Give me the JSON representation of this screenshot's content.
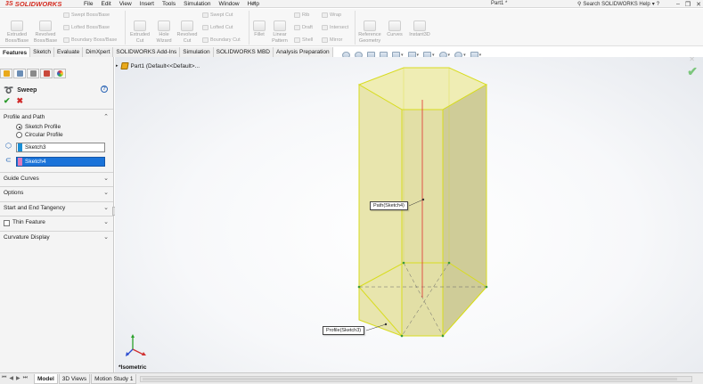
{
  "app": {
    "brand": "SOLIDWORKS",
    "brand_mark": "3S",
    "document_title": "Part1 *",
    "search_placeholder": "Search SOLIDWORKS Help",
    "menu": [
      "File",
      "Edit",
      "View",
      "Insert",
      "Tools",
      "Simulation",
      "Window",
      "Help"
    ]
  },
  "command_manager": {
    "extruded_boss": "Extruded Boss/Base",
    "revolved_boss": "Revolved Boss/Base",
    "swept_boss": "Swept Boss/Base",
    "lofted_boss": "Lofted Boss/Base",
    "boundary_boss": "Boundary Boss/Base",
    "extruded_cut": "Extruded Cut",
    "hole_wizard": "Hole Wizard",
    "revolved_cut": "Revolved Cut",
    "swept_cut": "Swept Cut",
    "lofted_cut": "Lofted Cut",
    "boundary_cut": "Boundary Cut",
    "fillet": "Fillet",
    "linear_pattern": "Linear Pattern",
    "rib": "Rib",
    "draft": "Draft",
    "shell": "Shell",
    "wrap": "Wrap",
    "intersect": "Intersect",
    "mirror": "Mirror",
    "reference_geometry": "Reference Geometry",
    "curves": "Curves",
    "instant3d": "Instant3D"
  },
  "tabs": [
    "Features",
    "Sketch",
    "Evaluate",
    "DimXpert",
    "SOLIDWORKS Add-Ins",
    "Simulation",
    "SOLIDWORKS MBD",
    "Analysis Preparation"
  ],
  "property_manager": {
    "title": "Sweep",
    "profile_and_path": "Profile and Path",
    "sketch_profile": "Sketch Profile",
    "circular_profile": "Circular Profile",
    "profile_value": "Sketch3",
    "path_value": "Sketch4",
    "guide_curves": "Guide Curves",
    "options": "Options",
    "start_end_tangency": "Start and End Tangency",
    "thin_feature": "Thin Feature",
    "curvature_display": "Curvature Display",
    "colors": {
      "profile_swatch": "#1a8fd6",
      "path_swatch": "#e07ab8",
      "selection_highlight": "#1a73d9"
    }
  },
  "graphics": {
    "tree_root": "Part1  (Default<<Default>...",
    "path_callout": "Path(Sketch4)",
    "profile_callout": "Profile(Sketch3)",
    "view_name": "*Isometric"
  },
  "bottom_tabs": [
    "Model",
    "3D Views",
    "Motion Study 1"
  ]
}
